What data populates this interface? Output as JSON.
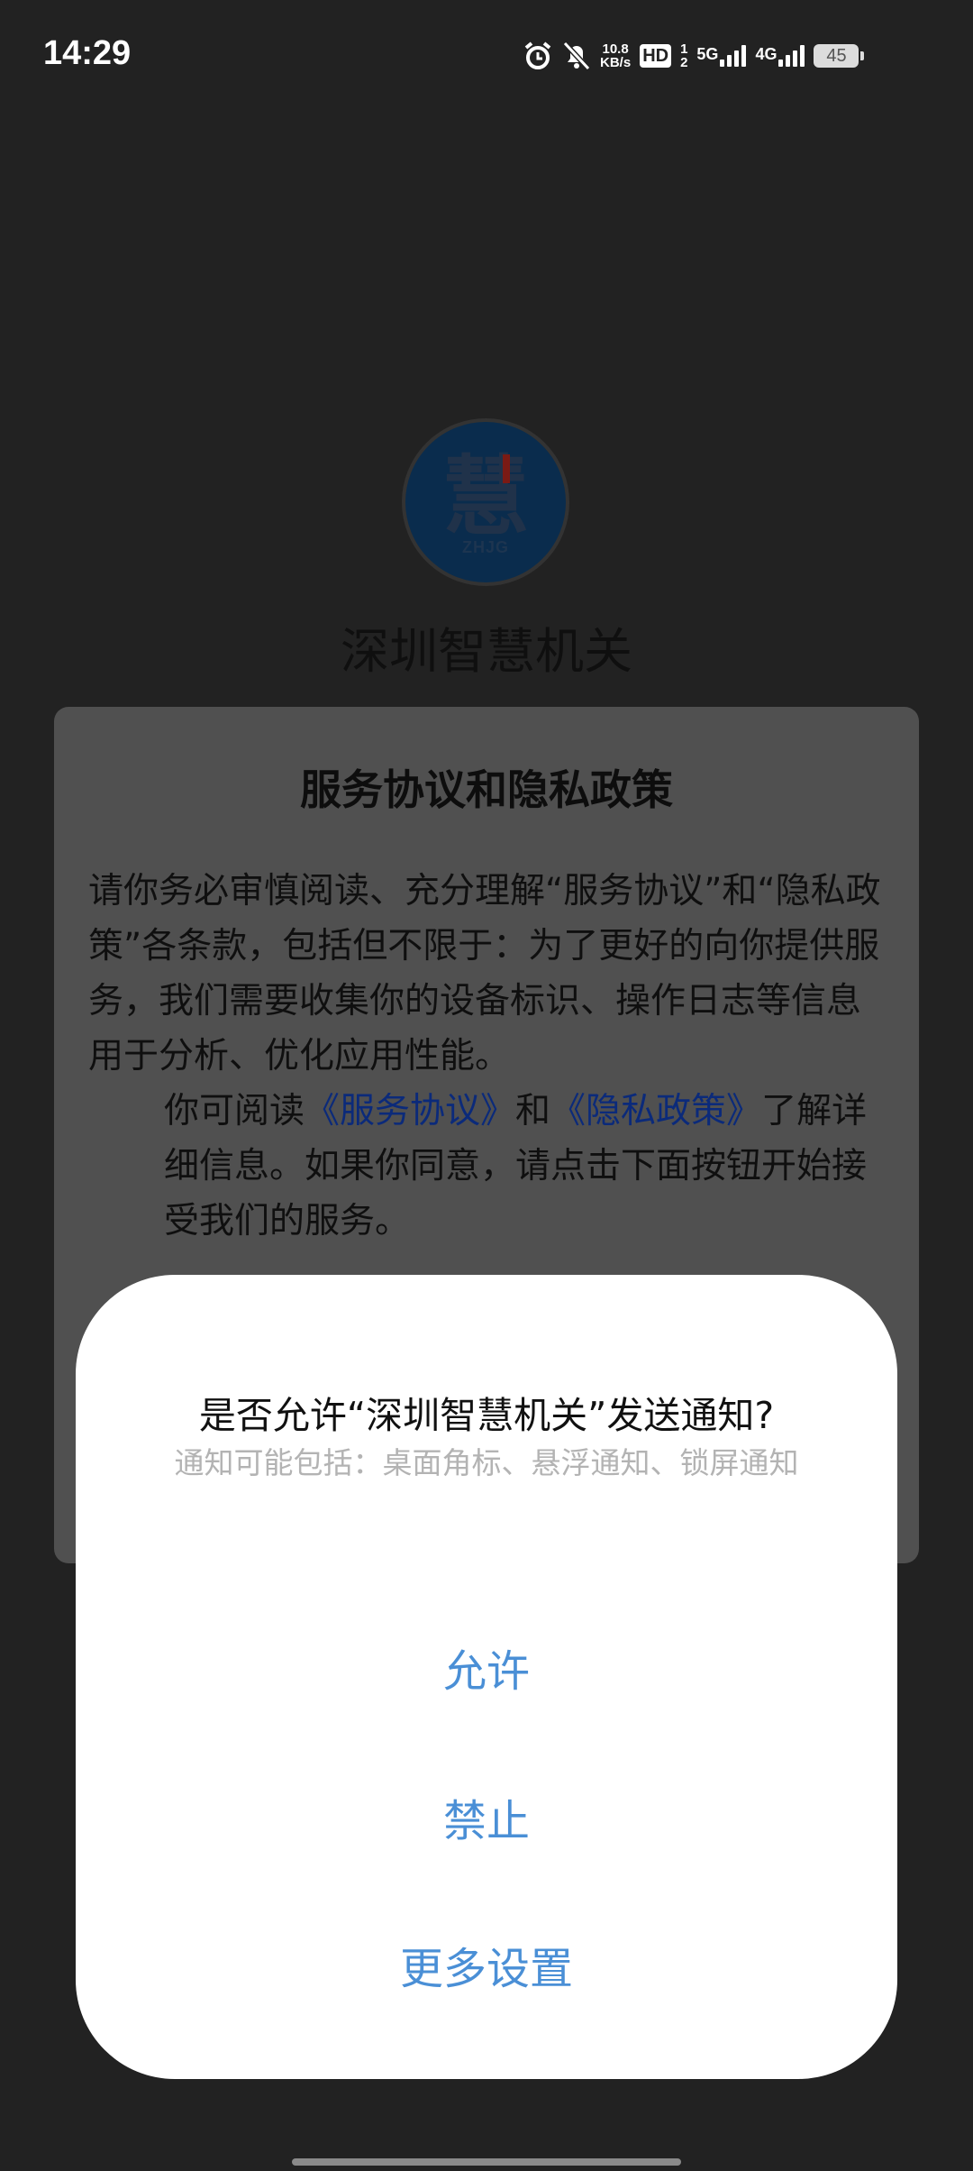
{
  "status_bar": {
    "time": "14:29",
    "speed_value": "10.8",
    "speed_unit": "KB/s",
    "hd_label": "HD",
    "sim1_label": "1",
    "sim2_label": "2",
    "net1_label": "5G",
    "net2_label": "4G",
    "battery": "45"
  },
  "app": {
    "logo_char": "慧",
    "logo_sub": "ZHJG",
    "name": "深圳智慧机关"
  },
  "privacy_dialog": {
    "title": "服务协议和隐私政策",
    "para1": "请你务必审慎阅读、充分理解“服务协议”和“隐私政策”各条款，包括但不限于：为了更好的向你提供服务，我们需要收集你的设备标识、操作日志等信息用于分析、优化应用性能。",
    "para2_prefix": "你可阅读",
    "link_service": "《服务协议》",
    "para2_and": "和",
    "link_privacy": "《隐私政策》",
    "para2_suffix": "了解详细信息。如果你同意，请点击下面按钮开始接受我们的服务。"
  },
  "notification_sheet": {
    "title": "是否允许“深圳智慧机关”发送通知?",
    "subtitle": "通知可能包括：桌面角标、悬浮通知、锁屏通知",
    "allow_label": "允许",
    "deny_label": "禁止",
    "more_label": "更多设置"
  },
  "colors": {
    "background": "#222222",
    "accent": "#4a8fd6",
    "link": "#0b2a7a"
  }
}
